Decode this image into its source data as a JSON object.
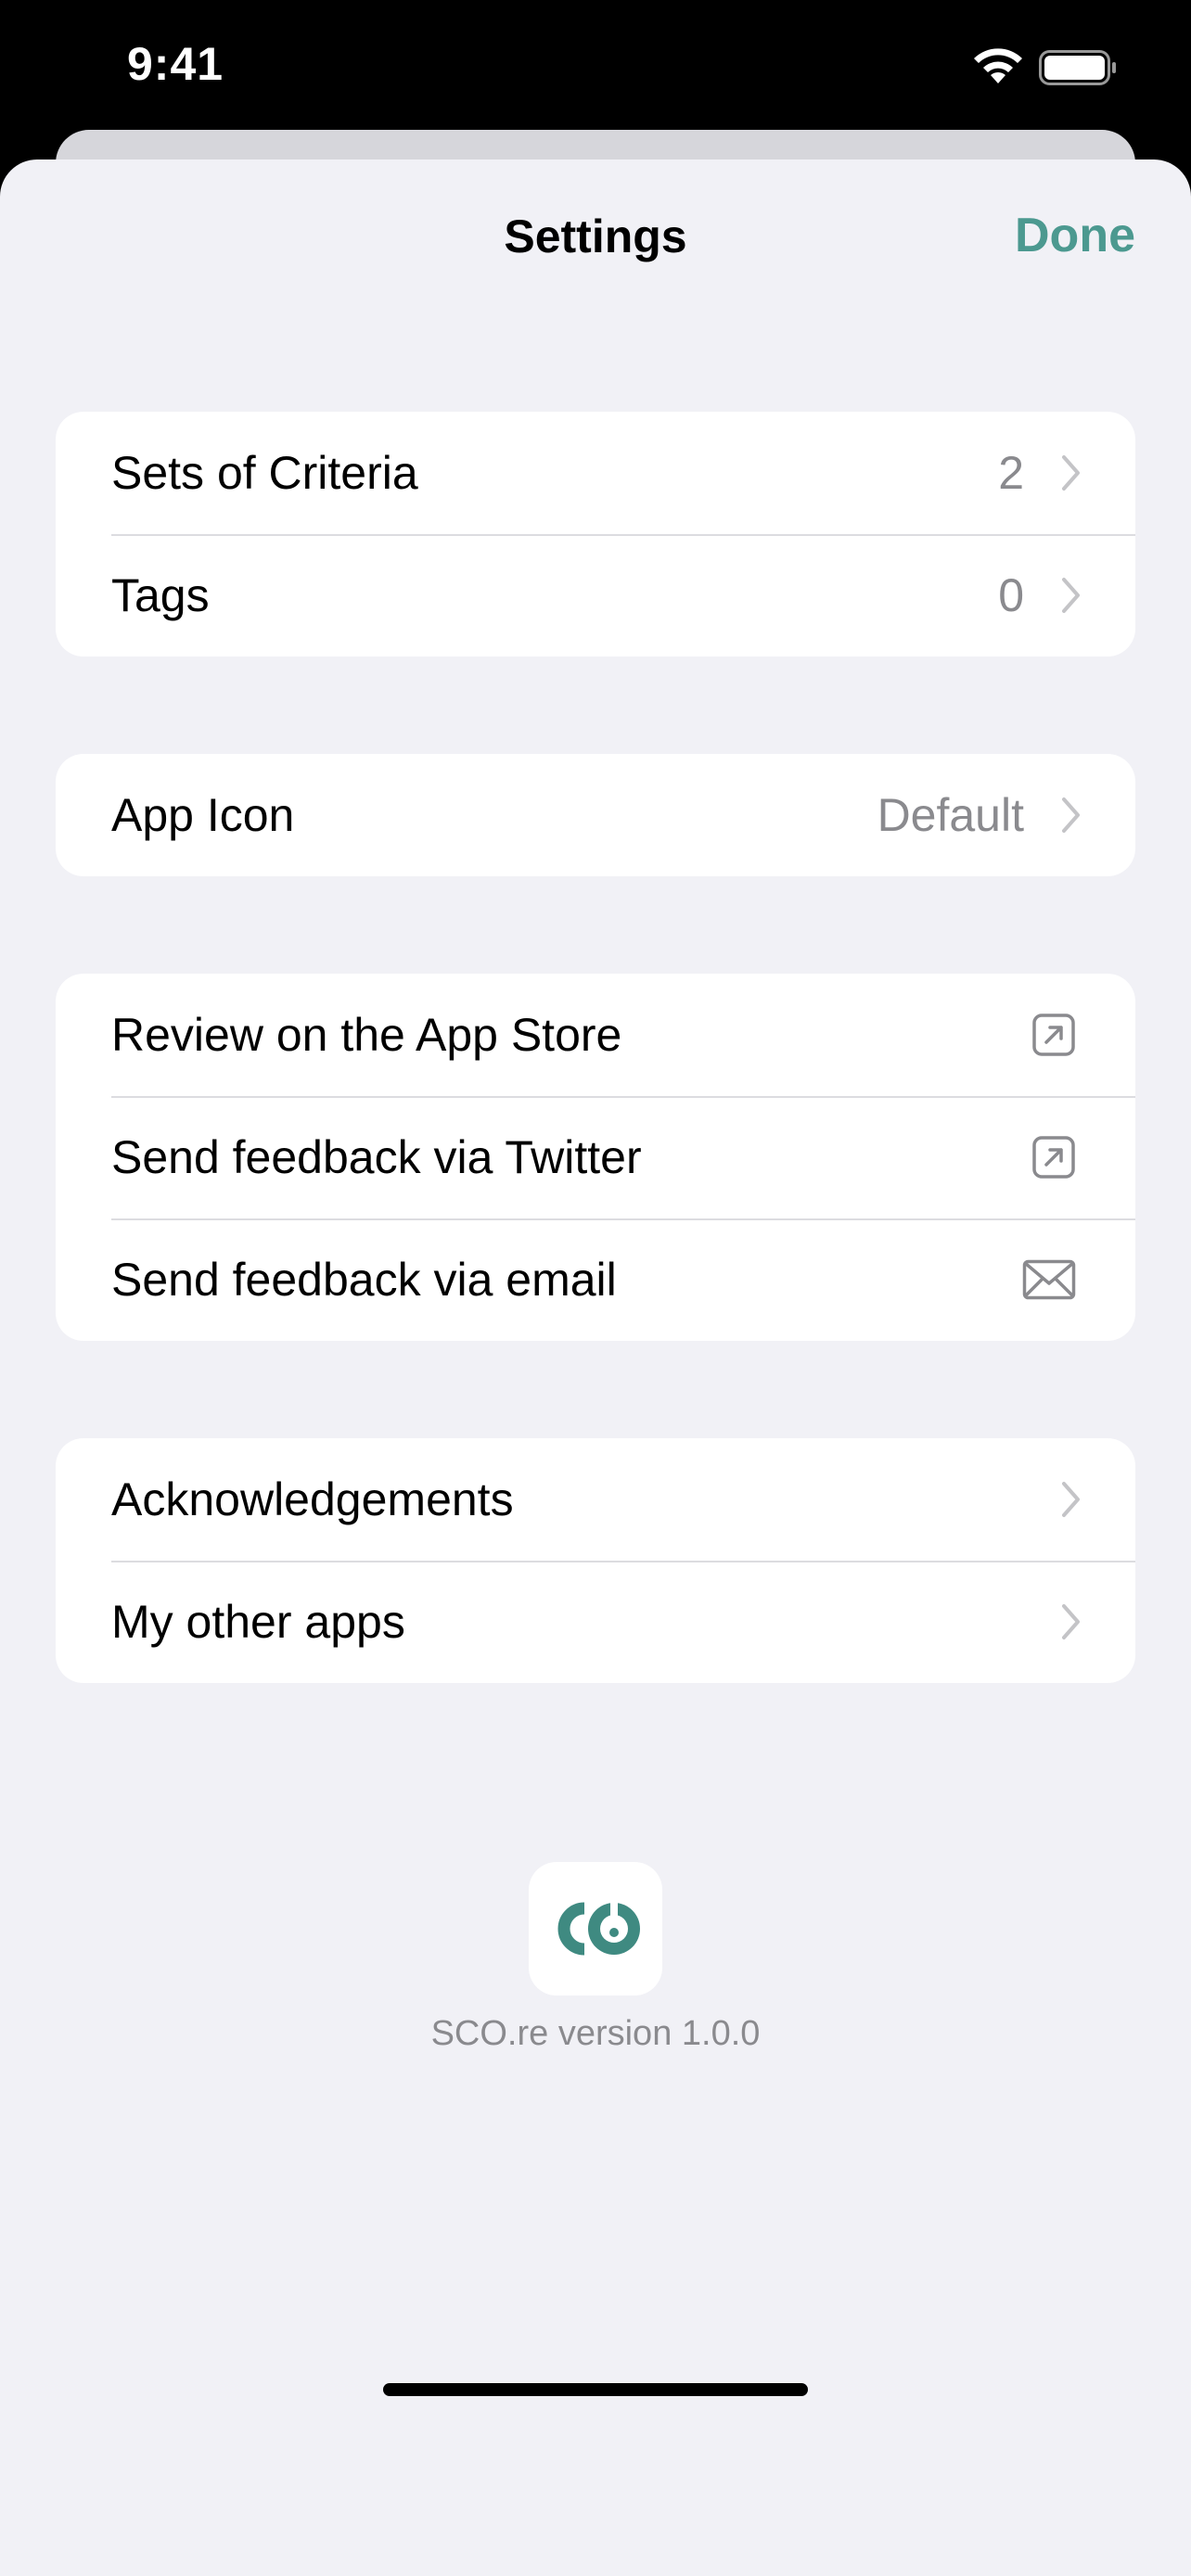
{
  "status_bar": {
    "time": "9:41"
  },
  "nav": {
    "title": "Settings",
    "done_label": "Done"
  },
  "groups": [
    {
      "rows": [
        {
          "label": "Sets of Criteria",
          "value": "2",
          "accessory": "chevron-icon"
        },
        {
          "label": "Tags",
          "value": "0",
          "accessory": "chevron-icon"
        }
      ]
    },
    {
      "rows": [
        {
          "label": "App Icon",
          "value": "Default",
          "accessory": "chevron-icon"
        }
      ]
    },
    {
      "rows": [
        {
          "label": "Review on the App Store",
          "accessory": "external-link-icon"
        },
        {
          "label": "Send feedback via Twitter",
          "accessory": "external-link-icon"
        },
        {
          "label": "Send feedback via email",
          "accessory": "envelope-icon"
        }
      ]
    },
    {
      "rows": [
        {
          "label": "Acknowledgements",
          "accessory": "chevron-icon"
        },
        {
          "label": "My other apps",
          "accessory": "chevron-icon"
        }
      ]
    }
  ],
  "footer": {
    "version_text": "SCO.re version 1.0.0",
    "logo_icon": "app-logo-icon"
  },
  "colors": {
    "accent": "#4c9990",
    "background": "#f1f1f6",
    "secondary_text": "#8a8a8e"
  }
}
